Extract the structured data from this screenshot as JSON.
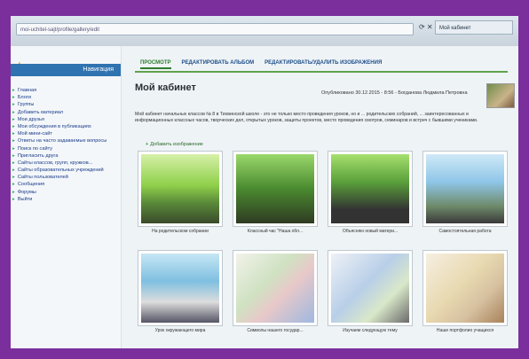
{
  "browser": {
    "url": "moi-uchitel-sajt/profile/gallery/edit",
    "tab_label": "Мой кабинет"
  },
  "sidebar": {
    "header": "Навигация",
    "items": [
      {
        "label": "Главная"
      },
      {
        "label": "Блоги"
      },
      {
        "label": "Группы"
      },
      {
        "label": "Добавить материал"
      },
      {
        "label": "Мои друзья"
      },
      {
        "label": "Мои обсуждения в публикациях"
      },
      {
        "label": "Мой мини-сайт"
      },
      {
        "label": "Ответы на часто задаваемые вопросы"
      },
      {
        "label": "Поиск по сайту"
      },
      {
        "label": "Пригласить друга"
      },
      {
        "label": "Сайты классов, групп, кружков..."
      },
      {
        "label": "Сайты образовательных учреждений"
      },
      {
        "label": "Сайты пользователей"
      },
      {
        "label": "Сообщения"
      },
      {
        "label": "Форумы"
      },
      {
        "label": "Выйти"
      }
    ]
  },
  "tabs": [
    {
      "label": "ПРОСМОТР"
    },
    {
      "label": "РЕДАКТИРОВАТЬ АЛЬБОМ"
    },
    {
      "label": "РЕДАКТИРОВАТЬ/УДАЛИТЬ ИЗОБРАЖЕНИЯ"
    }
  ],
  "page": {
    "title": "Мой кабинет",
    "meta": "Опубликовано 30.12.2015 - 8:56 - Богданова Людмила Петровна",
    "description": "Мой кабинет начальных классов № 8 в Тихвинской школе - это не только место проведения уроков, но и ... родительских собраний, ... заинтересованных и информационных классных часов, творческих дел, открытых уроков, защиты проектов, место проведения смотров, семинаров и встреч с бывшими учениками.",
    "add_image": "Добавить изображение"
  },
  "gallery": [
    {
      "caption": "На родительском собрании"
    },
    {
      "caption": "Классный час \"Наша обл..."
    },
    {
      "caption": "Объясняю новый матери..."
    },
    {
      "caption": "Самостоятельная работа"
    },
    {
      "caption": "Урок окружающего мира"
    },
    {
      "caption": "Символы нашего государ..."
    },
    {
      "caption": "Изучаем следующую тему"
    },
    {
      "caption": "Наше портфолио учащихся"
    }
  ]
}
